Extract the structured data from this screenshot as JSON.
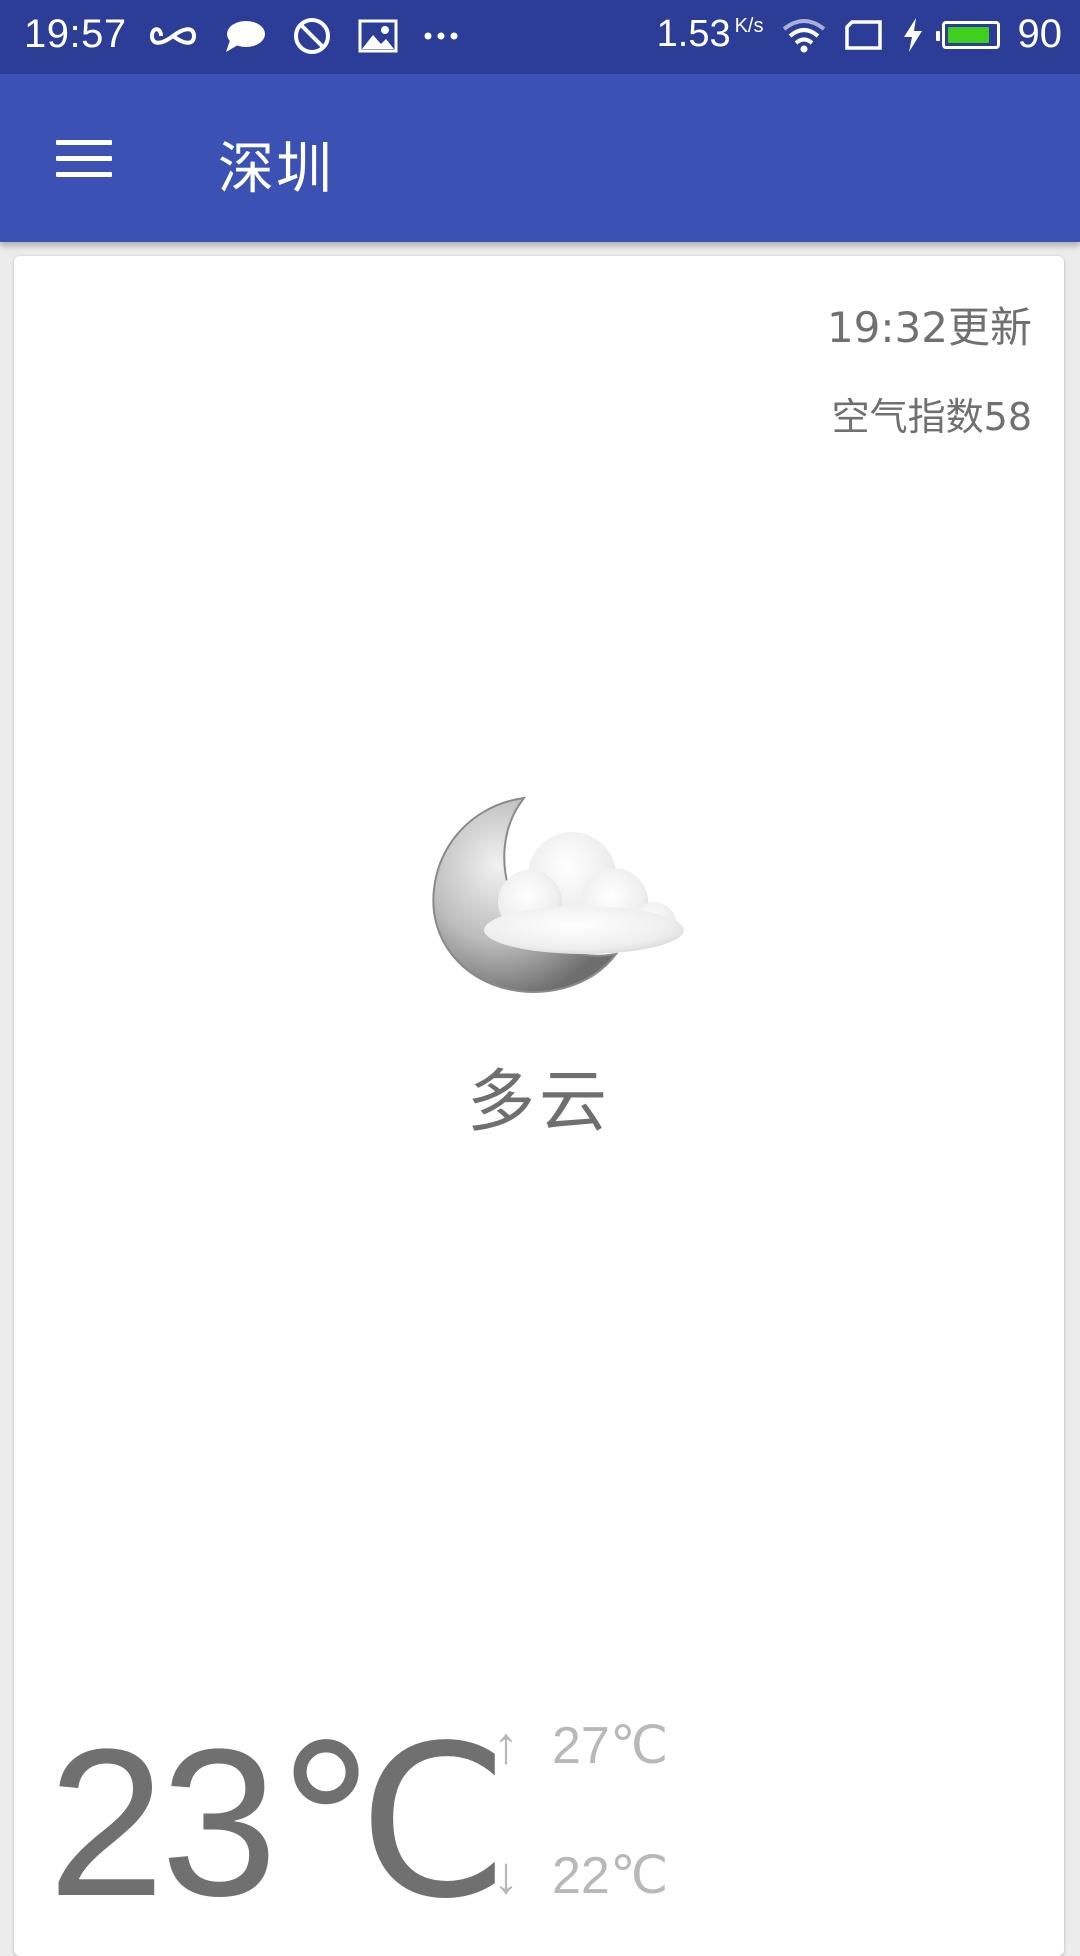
{
  "status_bar": {
    "time": "19:57",
    "left_icons": [
      "infinity-icon",
      "chat-bubble-icon",
      "block-icon",
      "image-icon",
      "more-dots-icon"
    ],
    "speed": "1.53",
    "speed_unit": "K/s",
    "battery_level": "90",
    "battery_fraction": 0.9,
    "battery_color": "#3fcf1f",
    "colors": {
      "background": "#2c3d98"
    }
  },
  "app_bar": {
    "title": "深圳",
    "menu_icon": "hamburger-menu-icon",
    "colors": {
      "background": "#3c51b4"
    }
  },
  "weather": {
    "update_time": "19:32更新",
    "air_quality": "空气指数58",
    "icon": "cloudy-night-moon-icon",
    "description": "多云",
    "temperature": "23℃",
    "high": "27℃",
    "low": "22℃",
    "high_arrow": "↑",
    "low_arrow": "↓"
  }
}
